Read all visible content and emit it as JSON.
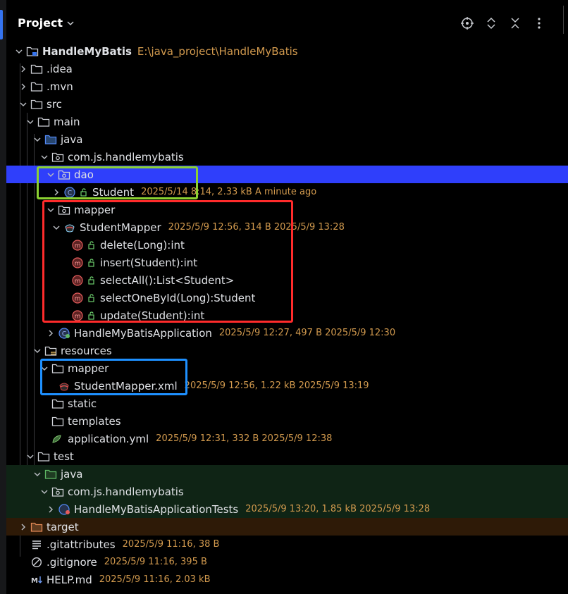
{
  "header": {
    "title": "Project"
  },
  "colors": {
    "selection": "#2f3ffb",
    "meta": "#d29a4e",
    "box_green": "#8bd131",
    "box_red": "#ff2b2b",
    "box_blue": "#1e90ff"
  },
  "tree": [
    {
      "label": "HandleMyBatis",
      "path": "E:\\java_project\\HandleMyBatis",
      "icon": "module-folder-icon"
    },
    {
      "label": ".idea",
      "icon": "folder-icon"
    },
    {
      "label": ".mvn",
      "icon": "folder-icon"
    },
    {
      "label": "src",
      "icon": "folder-icon"
    },
    {
      "label": "main",
      "icon": "folder-icon"
    },
    {
      "label": "java",
      "icon": "source-folder-icon"
    },
    {
      "label": "com.js.handlemybatis",
      "icon": "package-icon"
    },
    {
      "label": "dao",
      "icon": "package-icon"
    },
    {
      "label": "Student",
      "meta": "2025/5/14 8:14, 2.33 kB A minute ago",
      "icon": "class-icon"
    },
    {
      "label": "mapper",
      "icon": "package-icon"
    },
    {
      "label": "StudentMapper",
      "meta": "2025/5/9 12:56, 314 B 2025/5/9 13:28",
      "icon": "mybatis-interface-icon"
    },
    {
      "label": "delete(Long):int",
      "icon": "method-icon"
    },
    {
      "label": "insert(Student):int",
      "icon": "method-icon"
    },
    {
      "label": "selectAll():List<Student>",
      "icon": "method-icon"
    },
    {
      "label": "selectOneById(Long):Student",
      "icon": "method-icon"
    },
    {
      "label": "update(Student):int",
      "icon": "method-icon"
    },
    {
      "label": "HandleMyBatisApplication",
      "meta": "2025/5/9 12:27, 497 B 2025/5/9 12:30",
      "icon": "spring-app-icon"
    },
    {
      "label": "resources",
      "icon": "resources-folder-icon"
    },
    {
      "label": "mapper",
      "icon": "folder-icon"
    },
    {
      "label": "StudentMapper.xml",
      "meta": "2025/5/9 12:56, 1.22 kB 2025/5/9 13:19",
      "icon": "mybatis-xml-icon"
    },
    {
      "label": "static",
      "icon": "folder-icon"
    },
    {
      "label": "templates",
      "icon": "folder-icon"
    },
    {
      "label": "application.yml",
      "meta": "2025/5/9 12:31, 332 B 2025/5/9 12:38",
      "icon": "yaml-icon"
    },
    {
      "label": "test",
      "icon": "folder-icon"
    },
    {
      "label": "java",
      "icon": "test-folder-icon"
    },
    {
      "label": "com.js.handlemybatis",
      "icon": "package-icon"
    },
    {
      "label": "HandleMyBatisApplicationTests",
      "meta": "2025/5/9 13:20, 1.85 kB 2025/5/9 13:28",
      "icon": "test-class-icon"
    },
    {
      "label": "target",
      "icon": "excluded-folder-icon"
    },
    {
      "label": ".gitattributes",
      "meta": "2025/5/9 11:16, 38 B",
      "icon": "text-file-icon"
    },
    {
      "label": ".gitignore",
      "meta": "2025/5/9 11:16, 395 B",
      "icon": "ignore-file-icon"
    },
    {
      "label": "HELP.md",
      "meta": "2025/5/9 11:16, 2.03 kB",
      "icon": "markdown-icon"
    }
  ]
}
